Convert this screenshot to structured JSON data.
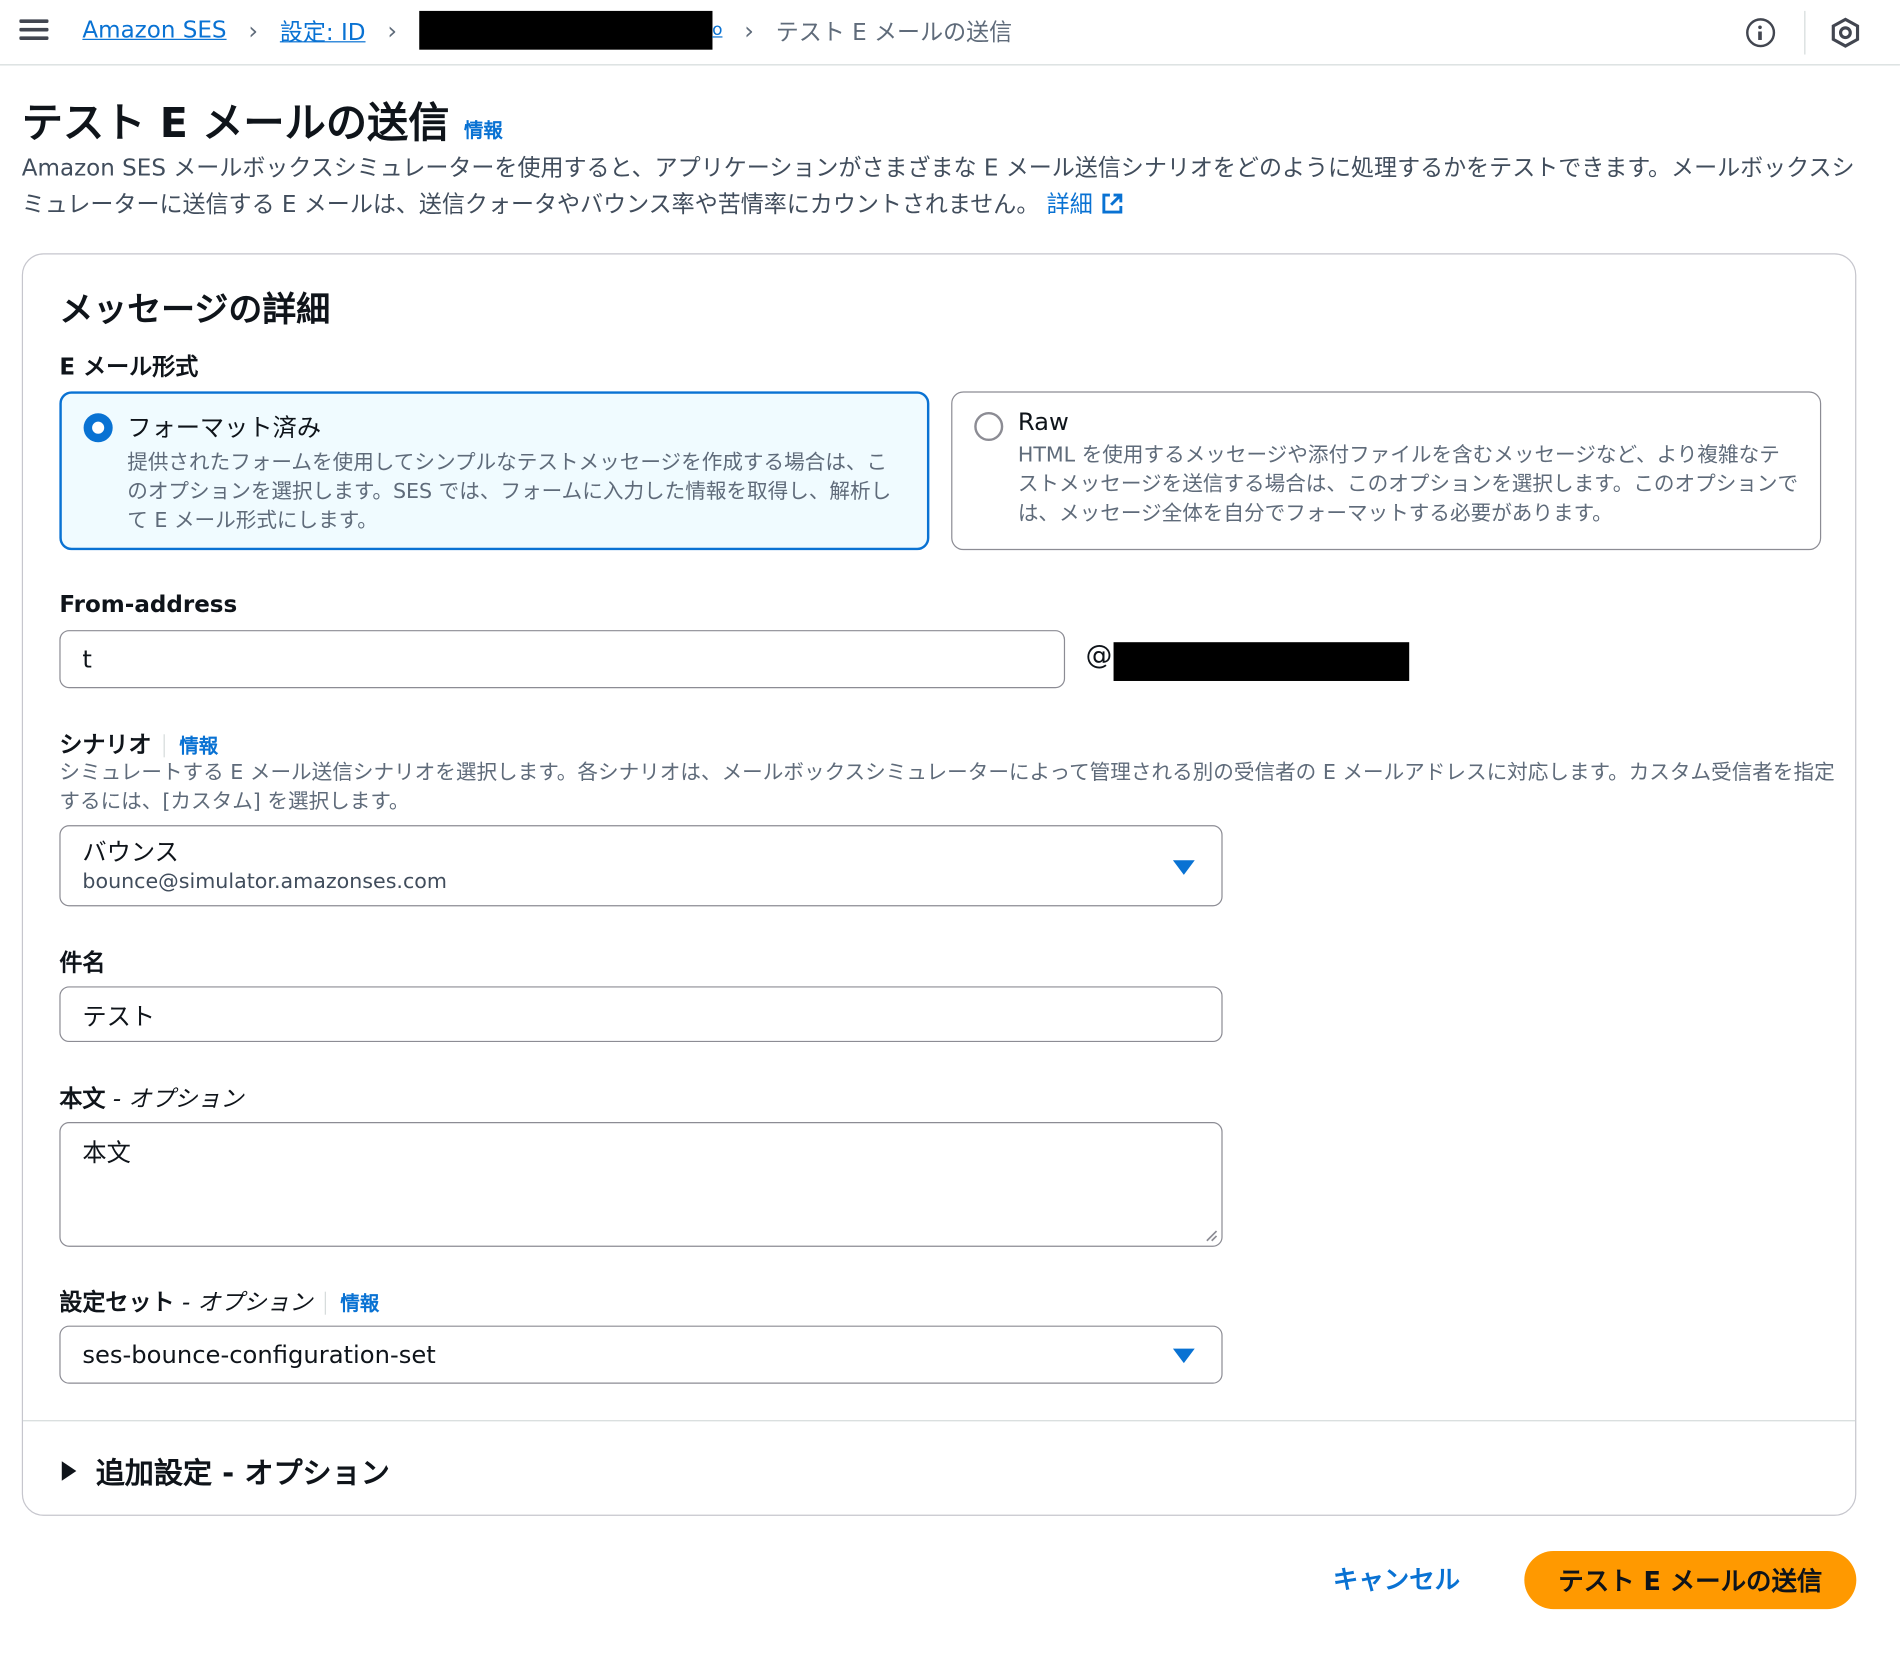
{
  "breadcrumb": {
    "items": [
      "Amazon SES",
      "設定: ID"
    ],
    "current": "テスト E メールの送信",
    "redacted_tail": "o"
  },
  "header": {
    "title": "テスト E メールの送信",
    "info": "情報",
    "description": "Amazon SES メールボックスシミュレーターを使用すると、アプリケーションがさまざまな E メール送信シナリオをどのように処理するかをテストできます。メールボックスシミュレーターに送信する E メールは、送信クォータやバウンス率や苦情率にカウントされません。",
    "more_link": "詳細"
  },
  "form": {
    "section_title": "メッセージの詳細",
    "email_format": {
      "label": "E メール形式",
      "options": [
        {
          "title": "フォーマット済み",
          "description": "提供されたフォームを使用してシンプルなテストメッセージを作成する場合は、このオプションを選択します。SES では、フォームに入力した情報を取得し、解析して E メール形式にします。",
          "selected": true
        },
        {
          "title": "Raw",
          "description": "HTML を使用するメッセージや添付ファイルを含むメッセージなど、より複雑なテストメッセージを送信する場合は、このオプションを選択します。このオプションでは、メッセージ全体を自分でフォーマットする必要があります。",
          "selected": false
        }
      ]
    },
    "from_address": {
      "label": "From-address",
      "value": "t",
      "at": "@"
    },
    "scenario": {
      "label": "シナリオ",
      "info": "情報",
      "hint": "シミュレートする E メール送信シナリオを選択します。各シナリオは、メールボックスシミュレーターによって管理される別の受信者の E メールアドレスに対応します。カスタム受信者を指定するには、[カスタム] を選択します。",
      "selected_label": "バウンス",
      "selected_sub": "bounce@simulator.amazonses.com"
    },
    "subject": {
      "label": "件名",
      "value": "テスト"
    },
    "body": {
      "label": "本文",
      "optional": " - オプション",
      "value": "本文"
    },
    "config_set": {
      "label": "設定セット",
      "optional": " - オプション",
      "info": "情報",
      "value": "ses-bounce-configuration-set"
    },
    "additional": {
      "label": "追加設定 - オプション"
    }
  },
  "actions": {
    "cancel": "キャンセル",
    "submit": "テスト E メールの送信"
  },
  "colors": {
    "link": "#0972d3",
    "primary": "#ff9900",
    "selected_bg": "#f0fbff"
  }
}
